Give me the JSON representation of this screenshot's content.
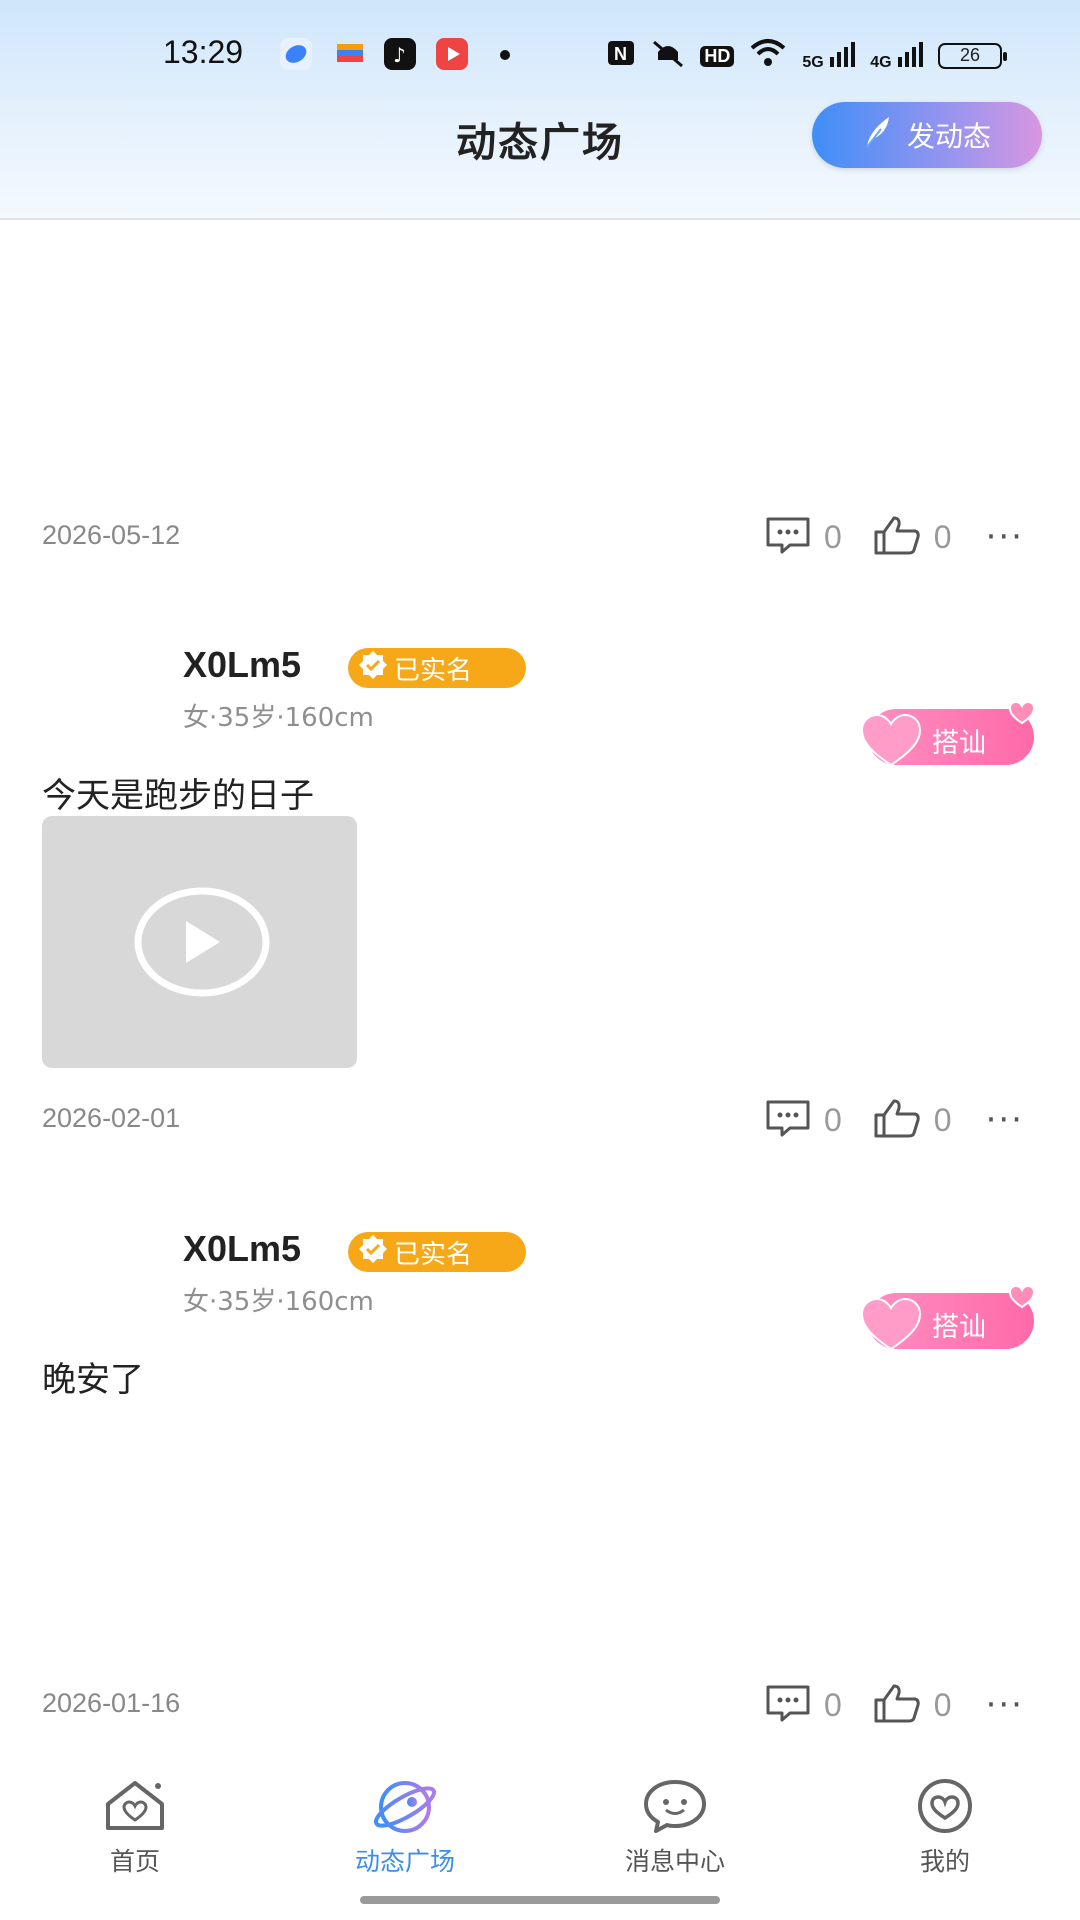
{
  "status_bar": {
    "time": "13:29",
    "network_labels": [
      "HD",
      "5G",
      "4G"
    ],
    "battery": "26"
  },
  "header": {
    "title": "动态广场",
    "post_button_label": "发动态"
  },
  "posts": [
    {
      "date": "2026-05-12",
      "comments": "0",
      "likes": "0"
    },
    {
      "username": "X0Lm5",
      "verified_label": "已实名",
      "info": "女·35岁·160cm",
      "chat_label": "搭讪",
      "text": "今天是跑步的日子",
      "has_video": true,
      "date": "2026-02-01",
      "comments": "0",
      "likes": "0"
    },
    {
      "username": "X0Lm5",
      "verified_label": "已实名",
      "info": "女·35岁·160cm",
      "chat_label": "搭讪",
      "text": "晚安了",
      "date": "2026-01-16",
      "comments": "0",
      "likes": "0"
    }
  ],
  "tabbar": {
    "items": [
      {
        "label": "首页",
        "icon": "home-icon"
      },
      {
        "label": "动态广场",
        "icon": "planet-icon",
        "active": true
      },
      {
        "label": "消息中心",
        "icon": "chat-bubble-icon"
      },
      {
        "label": "我的",
        "icon": "heart-profile-icon"
      }
    ]
  },
  "colors": {
    "accent": "#3a8ef0",
    "verified_badge": "#f7a818",
    "chat_button": "#ff6aa8"
  }
}
